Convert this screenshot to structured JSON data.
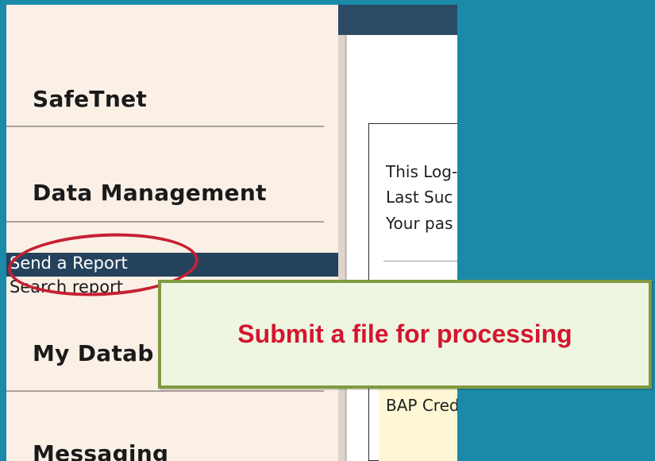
{
  "sidebar": {
    "sections": [
      {
        "label": "SafeTnet"
      },
      {
        "label": "Data Management"
      },
      {
        "label": "My Datab"
      },
      {
        "label": "Messaging"
      }
    ],
    "links": [
      {
        "label": "Send a Report",
        "selected": true
      },
      {
        "label": "Search report"
      }
    ]
  },
  "panel": {
    "lines": [
      "This Log-",
      "Last Suc",
      "Your pas",
      "BAP Cred"
    ]
  },
  "callout": {
    "text": "Submit a file for processing"
  },
  "colors": {
    "background": "#1a8aa8",
    "sidebar": "#faf0e6",
    "selected_nav": "#25425c",
    "highlight_circle": "#c62032",
    "callout_text": "#d3162f",
    "callout_border": "#7f9a3f"
  }
}
